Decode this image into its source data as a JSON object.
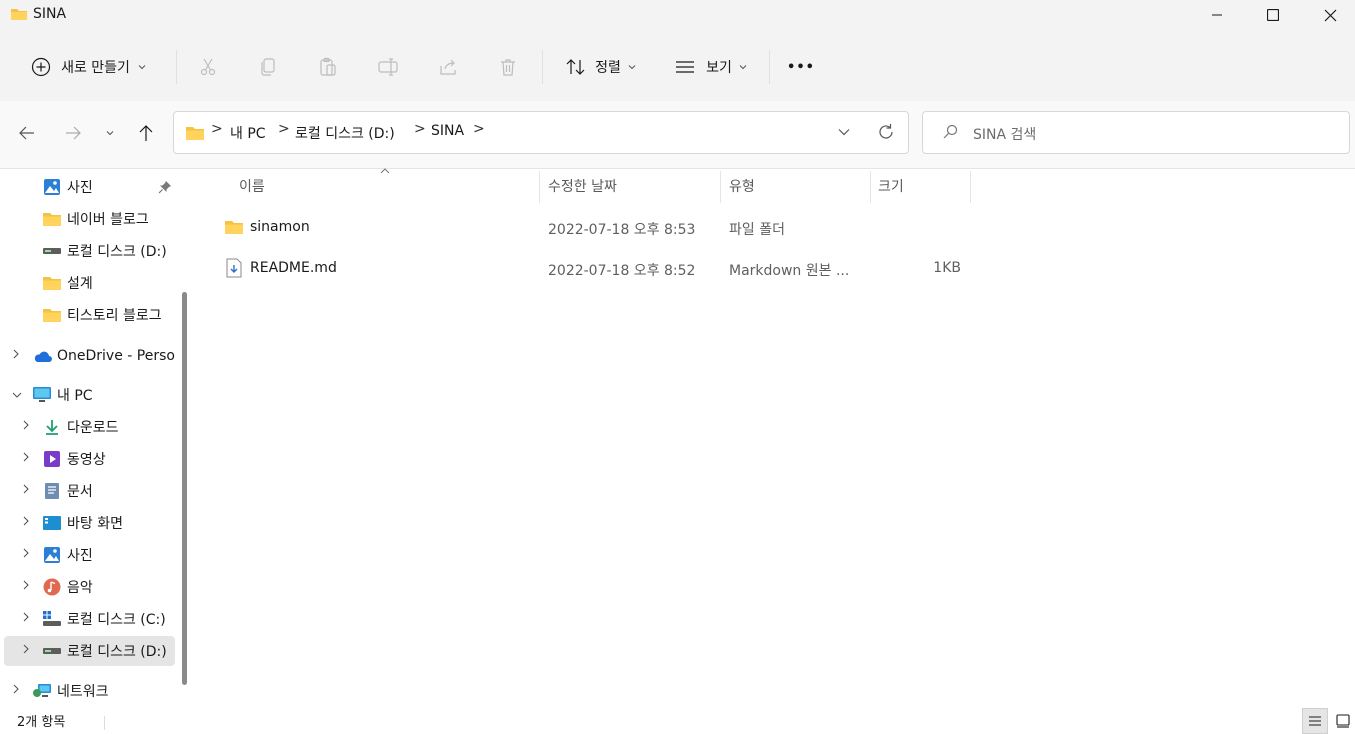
{
  "window": {
    "title": "SINA"
  },
  "toolbar": {
    "new_label": "새로 만들기",
    "sort_label": "정렬",
    "view_label": "보기",
    "more_label": "•••"
  },
  "address": {
    "crumbs": [
      "내 PC",
      "로컬 디스크 (D:)",
      "SINA"
    ],
    "separator": ">"
  },
  "search": {
    "placeholder": "SINA 검색"
  },
  "sidebar": {
    "items": [
      {
        "label": "사진",
        "icon": "pictures-icon",
        "pinned": true
      },
      {
        "label": "네이버 블로그",
        "icon": "folder-icon"
      },
      {
        "label": "로컬 디스크 (D:)",
        "icon": "drive-icon"
      },
      {
        "label": "설계",
        "icon": "folder-icon"
      },
      {
        "label": "티스토리 블로그",
        "icon": "folder-icon"
      },
      {
        "label": "OneDrive - Personal",
        "icon": "onedrive-icon"
      },
      {
        "label": "내 PC",
        "icon": "pc-icon"
      },
      {
        "label": "다운로드",
        "icon": "download-icon"
      },
      {
        "label": "동영상",
        "icon": "videos-icon"
      },
      {
        "label": "문서",
        "icon": "documents-icon"
      },
      {
        "label": "바탕 화면",
        "icon": "desktop-icon"
      },
      {
        "label": "사진",
        "icon": "pictures-icon"
      },
      {
        "label": "음악",
        "icon": "music-icon"
      },
      {
        "label": "로컬 디스크 (C:)",
        "icon": "system-drive-icon"
      },
      {
        "label": "로컬 디스크 (D:)",
        "icon": "drive-icon",
        "selected": true
      },
      {
        "label": "네트워크",
        "icon": "network-icon"
      }
    ]
  },
  "columns": {
    "name": "이름",
    "modified": "수정한 날짜",
    "type": "유형",
    "size": "크기"
  },
  "files": [
    {
      "name": "sinamon",
      "modified": "2022-07-18 오후 8:53",
      "type": "파일 폴더",
      "size": "",
      "icon": "folder-icon"
    },
    {
      "name": "README.md",
      "modified": "2022-07-18 오후 8:52",
      "type": "Markdown 원본 ...",
      "size": "1KB",
      "icon": "markdown-file-icon"
    }
  ],
  "status": {
    "item_count": "2개 항목"
  },
  "colors": {
    "folder": "#f5c242",
    "accent": "#0067c0",
    "selected_bg": "#e5e5e5"
  }
}
